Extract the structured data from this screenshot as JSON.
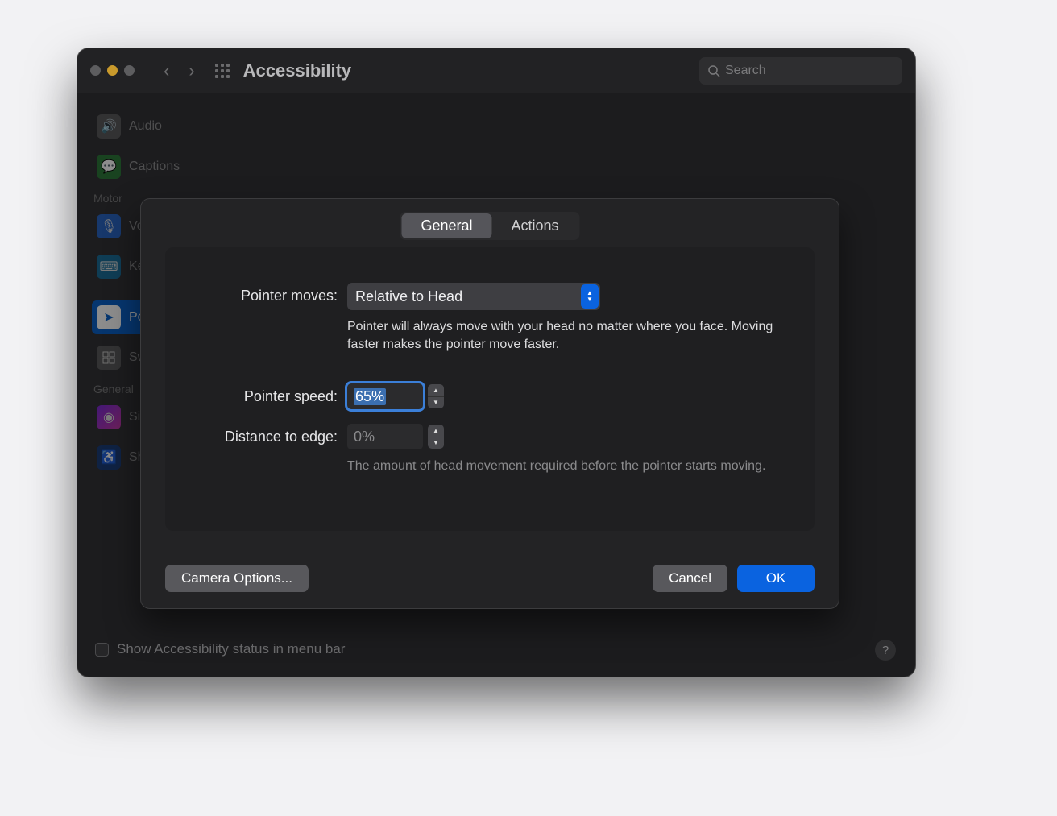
{
  "window": {
    "title": "Accessibility",
    "search_placeholder": "Search"
  },
  "sidebar": {
    "items": [
      {
        "label": "Audio",
        "icon": "audio-icon"
      },
      {
        "label": "Captions",
        "icon": "captions-icon"
      }
    ],
    "motor_header": "Motor",
    "motor_items": [
      {
        "label": "Voice Control",
        "icon": "voice-icon"
      },
      {
        "label": "Keyboard",
        "icon": "keyboard-icon"
      },
      {
        "label": "Pointer Control",
        "icon": "pointer-icon",
        "selected": true
      },
      {
        "label": "Switch Control",
        "icon": "switch-icon"
      }
    ],
    "general_header": "General",
    "general_items": [
      {
        "label": "Siri",
        "icon": "siri-icon"
      },
      {
        "label": "Shortcut",
        "icon": "shortcut-icon"
      }
    ]
  },
  "footer": {
    "show_status_label": "Show Accessibility status in menu bar"
  },
  "sheet": {
    "tabs": {
      "general": "General",
      "actions": "Actions"
    },
    "pointer_moves": {
      "label": "Pointer moves:",
      "value": "Relative to Head",
      "help": "Pointer will always move with your head no matter where you face. Moving faster makes the pointer move faster."
    },
    "pointer_speed": {
      "label": "Pointer speed:",
      "value": "65%"
    },
    "distance_to_edge": {
      "label": "Distance to edge:",
      "value": "0%",
      "help": "The amount of head movement required before the pointer starts moving."
    },
    "buttons": {
      "camera_options": "Camera Options...",
      "cancel": "Cancel",
      "ok": "OK"
    }
  }
}
